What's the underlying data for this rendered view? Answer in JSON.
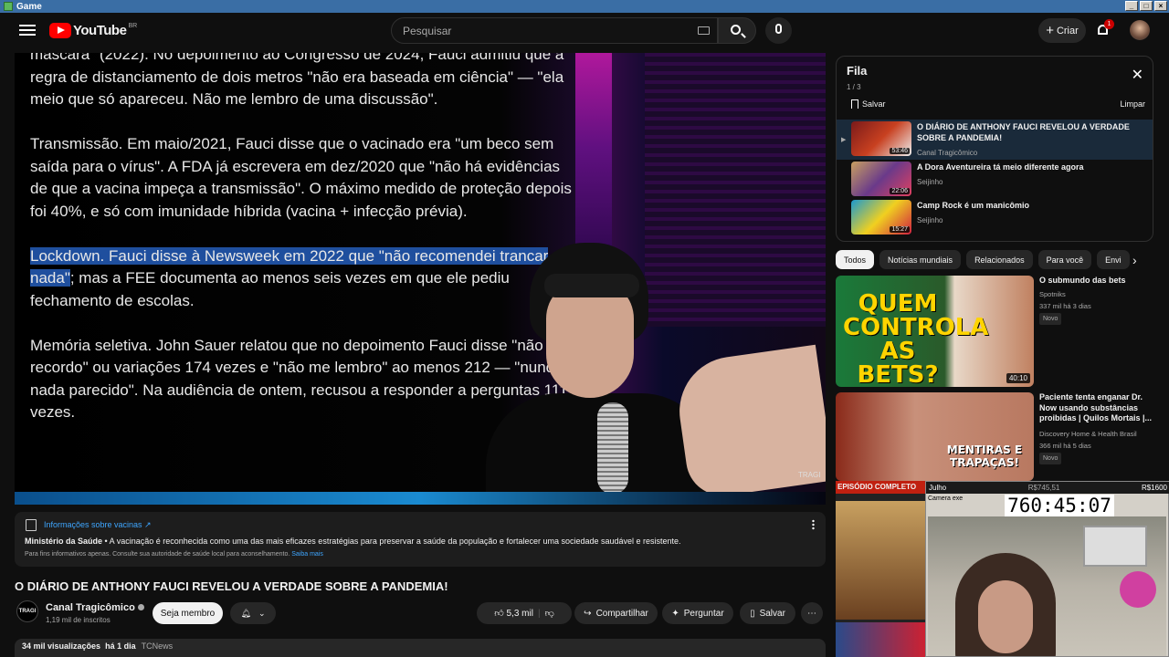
{
  "window": {
    "title": "Game"
  },
  "header": {
    "logo_text": "YouTube",
    "country_code": "BR",
    "search_placeholder": "Pesquisar",
    "create_label": "Criar",
    "notifications_count": "1"
  },
  "video": {
    "paragraph1": "máscara\" (2022). No depoimento ao Congresso de 2024, Fauci admitiu que a regra de distanciamento de dois metros \"não era baseada em ciência\" — \"ela meio que só apareceu. Não me lembro de uma discussão\".",
    "paragraph2": "Transmissão. Em maio/2021, Fauci disse que o vacinado era \"um beco sem saída para o vírus\". A FDA já escrevera em dez/2020 que \"não há evidências de que a vacina impeça a transmissão\". O máximo medido de proteção depois foi 40%, e só com imunidade híbrida (vacina + infecção prévia).",
    "paragraph3_highlight": "Lockdown. Fauci disse à Newsweek em 2022 que \"não recomendei trancar nada\"",
    "paragraph3_rest": "; mas a FEE documenta ao menos seis vezes em que ele pediu fechamento de escolas.",
    "paragraph4": "Memória seletiva. John Sauer relatou que no depoimento Fauci disse \"não me recordo\" ou variações 174 vezes e \"não me lembro\" ao menos 212 — \"nunca vi nada parecido\". Na audiência de ontem, recusou a responder a perguntas 111 vezes.",
    "watermark": "TRAGI"
  },
  "info_panel": {
    "link": "Informações sobre vacinas ↗",
    "source": "Ministério da Saúde",
    "body": " • A vacinação é reconhecida como uma das mais eficazes estratégias para preservar a saúde da população e fortalecer uma sociedade saudável e resistente.",
    "footer": "Para fins informativos apenas. Consulte sua autoridade de saúde local para aconselhamento.",
    "footer_link": "Saiba mais"
  },
  "meta": {
    "title": "O DIÁRIO DE ANTHONY FAUCI REVELOU A VERDADE SOBRE A PANDEMIA!",
    "channel_avatar_text": "TRAGI",
    "channel": "Canal Tragicômico",
    "subscribers": "1,19 mil de inscritos",
    "join_label": "Seja membro",
    "likes": "5,3 mil",
    "share_label": "Compartilhar",
    "ask_label": "Perguntar",
    "save_label": "Salvar",
    "views": "34 mil visualizações",
    "date": "há 1 dia",
    "hashtag": "TCNews"
  },
  "queue": {
    "title": "Fila",
    "count": "1 / 3",
    "save_label": "Salvar",
    "clear_label": "Limpar",
    "items": [
      {
        "title": "O DIÁRIO DE ANTHONY FAUCI REVELOU A VERDADE SOBRE A PANDEMIA!",
        "channel": "Canal Tragicômico",
        "duration": "53:46"
      },
      {
        "title": "A Dora Aventureira tá meio diferente agora",
        "channel": "Seijinho",
        "duration": "22:06"
      },
      {
        "title": "Camp Rock é um manicômio",
        "channel": "Seijinho",
        "duration": "15:27"
      }
    ]
  },
  "chips": [
    "Todos",
    "Notícias mundiais",
    "Relacionados",
    "Para você",
    "Envi"
  ],
  "recommendations": [
    {
      "title": "O submundo das bets",
      "channel": "Spotniks",
      "stats": "337 mil  há 3 dias",
      "badge": "Novo",
      "duration": "40:10",
      "thumb_text": "QUEM CONTROLA AS BETS?"
    },
    {
      "title": "Paciente tenta enganar Dr. Now usando substâncias proibidas | Quilos Mortais |...",
      "channel": "Discovery Home & Health Brasil",
      "stats": "366 mil  há 5 dias",
      "badge": "Novo",
      "thumb_text": "MENTIRAS E TRAPAÇAS!",
      "thumb_label": "EPISÓDIO COMPLETO"
    }
  ],
  "overlay": {
    "left_label": "Julho",
    "mid_value": "R$745,51",
    "right_value": "R$1600",
    "window_label": "Camera exe",
    "timer": "760:45:07"
  }
}
